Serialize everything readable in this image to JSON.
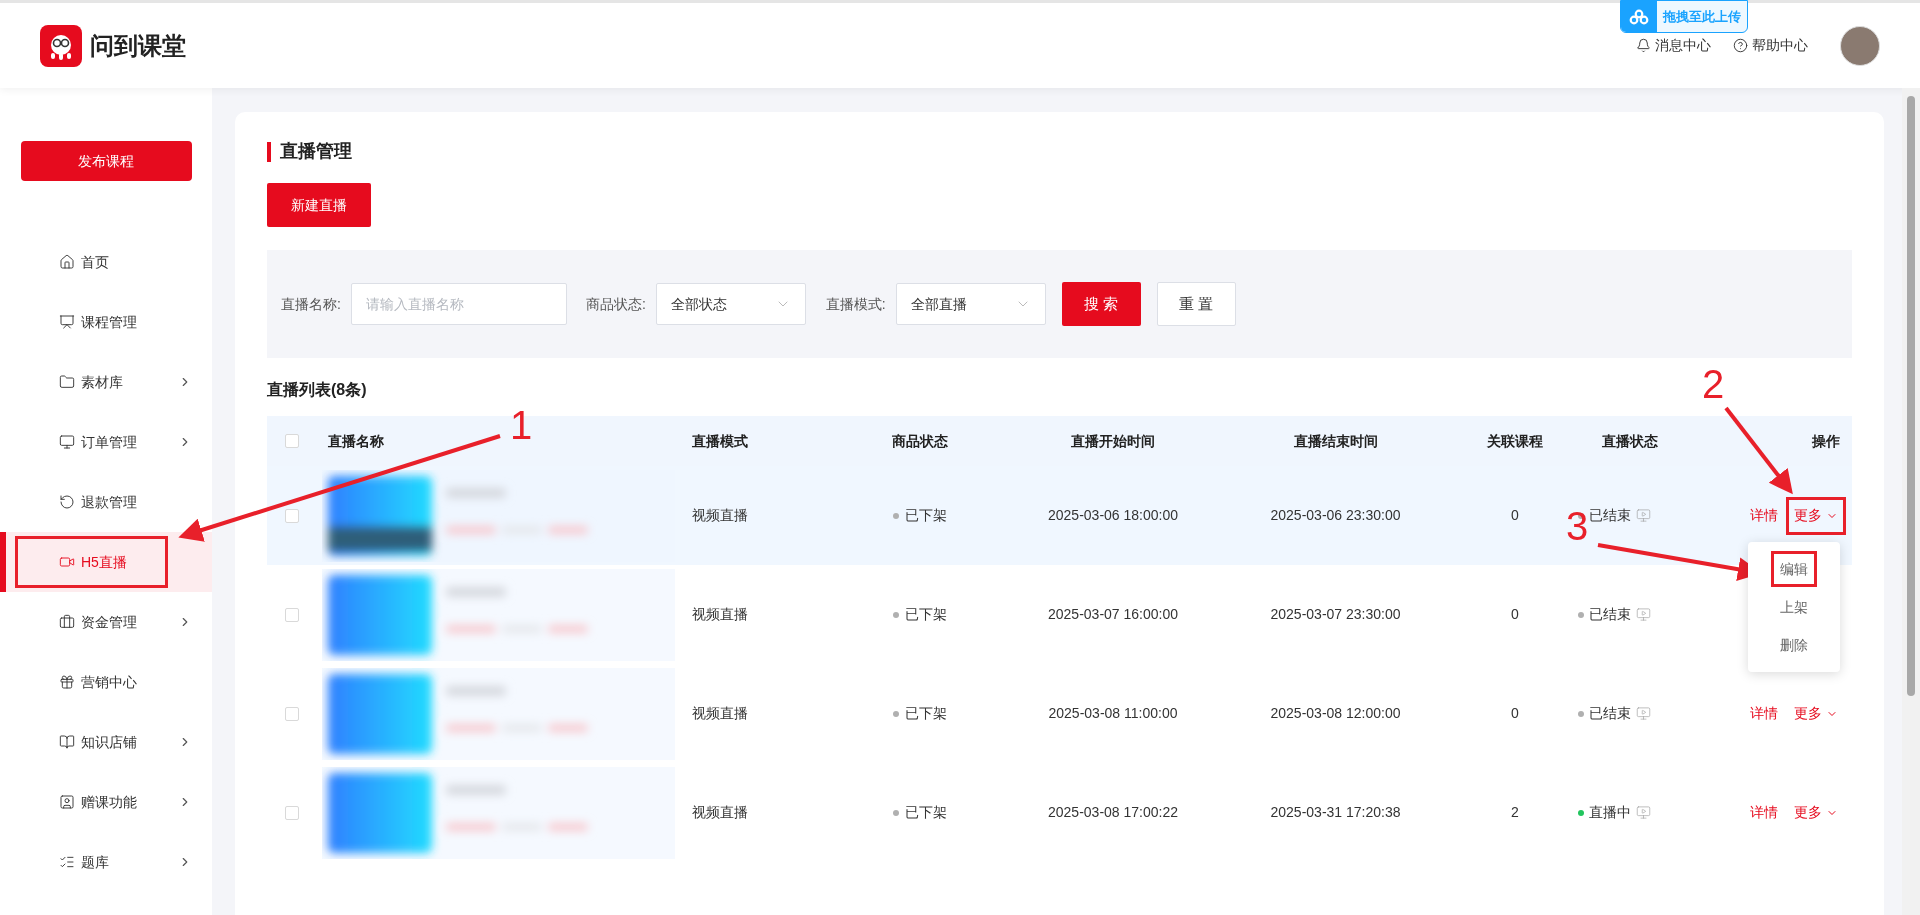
{
  "header": {
    "logo_text": "问到课堂",
    "upload_badge": "拖拽至此上传",
    "links": [
      {
        "label": "消息中心"
      },
      {
        "label": "帮助中心"
      }
    ]
  },
  "sidebar": {
    "publish_button": "发布课程",
    "items": [
      {
        "label": "首页",
        "expandable": false,
        "selected": false,
        "highlighted": false
      },
      {
        "label": "课程管理",
        "expandable": false,
        "selected": false,
        "highlighted": false
      },
      {
        "label": "素材库",
        "expandable": true,
        "selected": false,
        "highlighted": false
      },
      {
        "label": "订单管理",
        "expandable": true,
        "selected": false,
        "highlighted": false
      },
      {
        "label": "退款管理",
        "expandable": false,
        "selected": false,
        "highlighted": false
      },
      {
        "label": "H5直播",
        "expandable": false,
        "selected": true,
        "highlighted": true
      },
      {
        "label": "资金管理",
        "expandable": true,
        "selected": false,
        "highlighted": false
      },
      {
        "label": "营销中心",
        "expandable": false,
        "selected": false,
        "highlighted": false
      },
      {
        "label": "知识店铺",
        "expandable": true,
        "selected": false,
        "highlighted": false
      },
      {
        "label": "赠课功能",
        "expandable": true,
        "selected": false,
        "highlighted": false
      },
      {
        "label": "题库",
        "expandable": true,
        "selected": false,
        "highlighted": false
      }
    ]
  },
  "page": {
    "title": "直播管理",
    "new_button": "新建直播",
    "filters": {
      "name_label": "直播名称:",
      "name_placeholder": "请输入直播名称",
      "goods_label": "商品状态:",
      "goods_value": "全部状态",
      "mode_label": "直播模式:",
      "mode_value": "全部直播",
      "search_button": "搜 索",
      "reset_button": "重 置"
    },
    "list_title": "直播列表(8条)",
    "table": {
      "header_checked": false,
      "columns": [
        "直播名称",
        "直播模式",
        "商品状态",
        "直播开始时间",
        "直播结束时间",
        "关联课程",
        "直播状态",
        "操作"
      ],
      "rows": [
        {
          "hovered": true,
          "checked": false,
          "mode": "视频直播",
          "goods_status": "已下架",
          "start": "2025-03-06 18:00:00",
          "end": "2025-03-06 23:30:00",
          "courses": "0",
          "status": "已结束",
          "color": "#b0b0b0",
          "detail": "详情",
          "more": "更多",
          "more_highlighted": true
        },
        {
          "hovered": false,
          "checked": false,
          "mode": "视频直播",
          "goods_status": "已下架",
          "start": "2025-03-07 16:00:00",
          "end": "2025-03-07 23:30:00",
          "courses": "0",
          "status": "已结束",
          "color": "#b0b0b0"
        },
        {
          "hovered": false,
          "checked": false,
          "mode": "视频直播",
          "goods_status": "已下架",
          "start": "2025-03-08 11:00:00",
          "end": "2025-03-08 12:00:00",
          "courses": "0",
          "status": "已结束",
          "color": "#b0b0b0",
          "detail": "详情",
          "more": "更多",
          "more_highlighted": false
        },
        {
          "hovered": false,
          "checked": false,
          "mode": "视频直播",
          "goods_status": "已下架",
          "start": "2025-03-08 17:00:22",
          "end": "2025-03-31 17:20:38",
          "courses": "2",
          "status": "直播中",
          "color": "#22c55e",
          "detail": "详情",
          "more": "更多",
          "more_highlighted": false
        }
      ]
    },
    "more_menu": [
      {
        "label": "编辑",
        "highlighted": true
      },
      {
        "label": "上架",
        "highlighted": false
      },
      {
        "label": "删除",
        "highlighted": false
      }
    ]
  },
  "annotations": [
    {
      "label": "1"
    },
    {
      "label": "2"
    },
    {
      "label": "3"
    }
  ]
}
